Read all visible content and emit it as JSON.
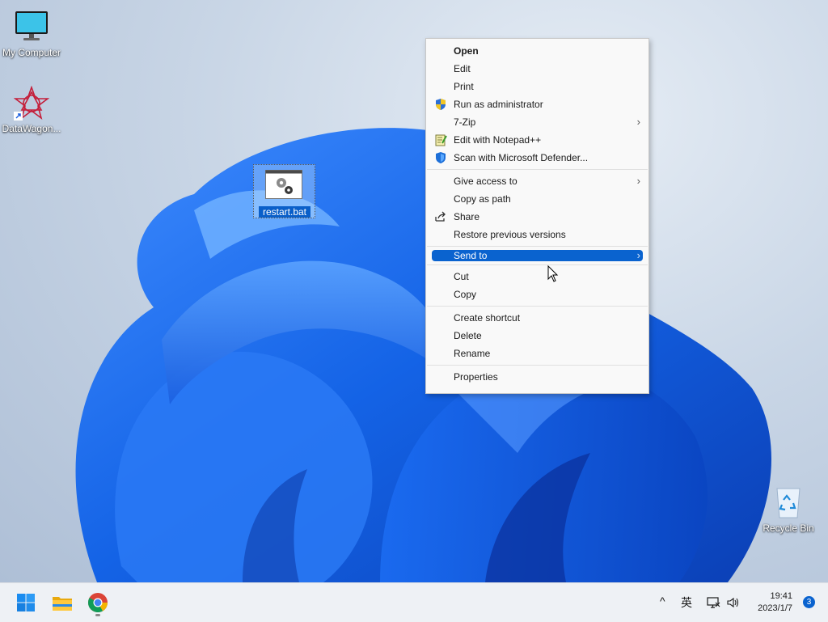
{
  "desktop": {
    "icons": [
      {
        "label": "My Computer"
      },
      {
        "label": "DataWagon..."
      },
      {
        "label": "restart.bat"
      },
      {
        "label": "Recycle Bin"
      }
    ]
  },
  "context_menu": {
    "group1": [
      {
        "label": "Open",
        "bold": true
      },
      {
        "label": "Edit"
      },
      {
        "label": "Print"
      },
      {
        "label": "Run as administrator",
        "icon": "shield-icon"
      },
      {
        "label": "7-Zip",
        "submenu": true
      },
      {
        "label": "Edit with Notepad++",
        "icon": "notepadpp-icon"
      },
      {
        "label": "Scan with Microsoft Defender...",
        "icon": "defender-icon"
      }
    ],
    "group2": [
      {
        "label": "Give access to",
        "submenu": true
      },
      {
        "label": "Copy as path"
      },
      {
        "label": "Share",
        "icon": "share-icon"
      },
      {
        "label": "Restore previous versions"
      }
    ],
    "group3": [
      {
        "label": "Send to",
        "submenu": true,
        "highlighted": true
      }
    ],
    "group4": [
      {
        "label": "Cut"
      },
      {
        "label": "Copy"
      }
    ],
    "group5": [
      {
        "label": "Create shortcut"
      },
      {
        "label": "Delete"
      },
      {
        "label": "Rename"
      }
    ],
    "group6": [
      {
        "label": "Properties"
      }
    ],
    "submenu_arrow": "›"
  },
  "taskbar": {
    "apps": [
      {
        "name": "start-icon"
      },
      {
        "name": "file-explorer-icon"
      },
      {
        "name": "chrome-icon"
      }
    ],
    "tray": {
      "chevron": "^",
      "ime": "英",
      "time": "19:41",
      "date": "2023/1/7",
      "notification_count": "3"
    }
  },
  "colors": {
    "accent": "#0a63cf",
    "wallpaper_blue": "#1565e0"
  }
}
